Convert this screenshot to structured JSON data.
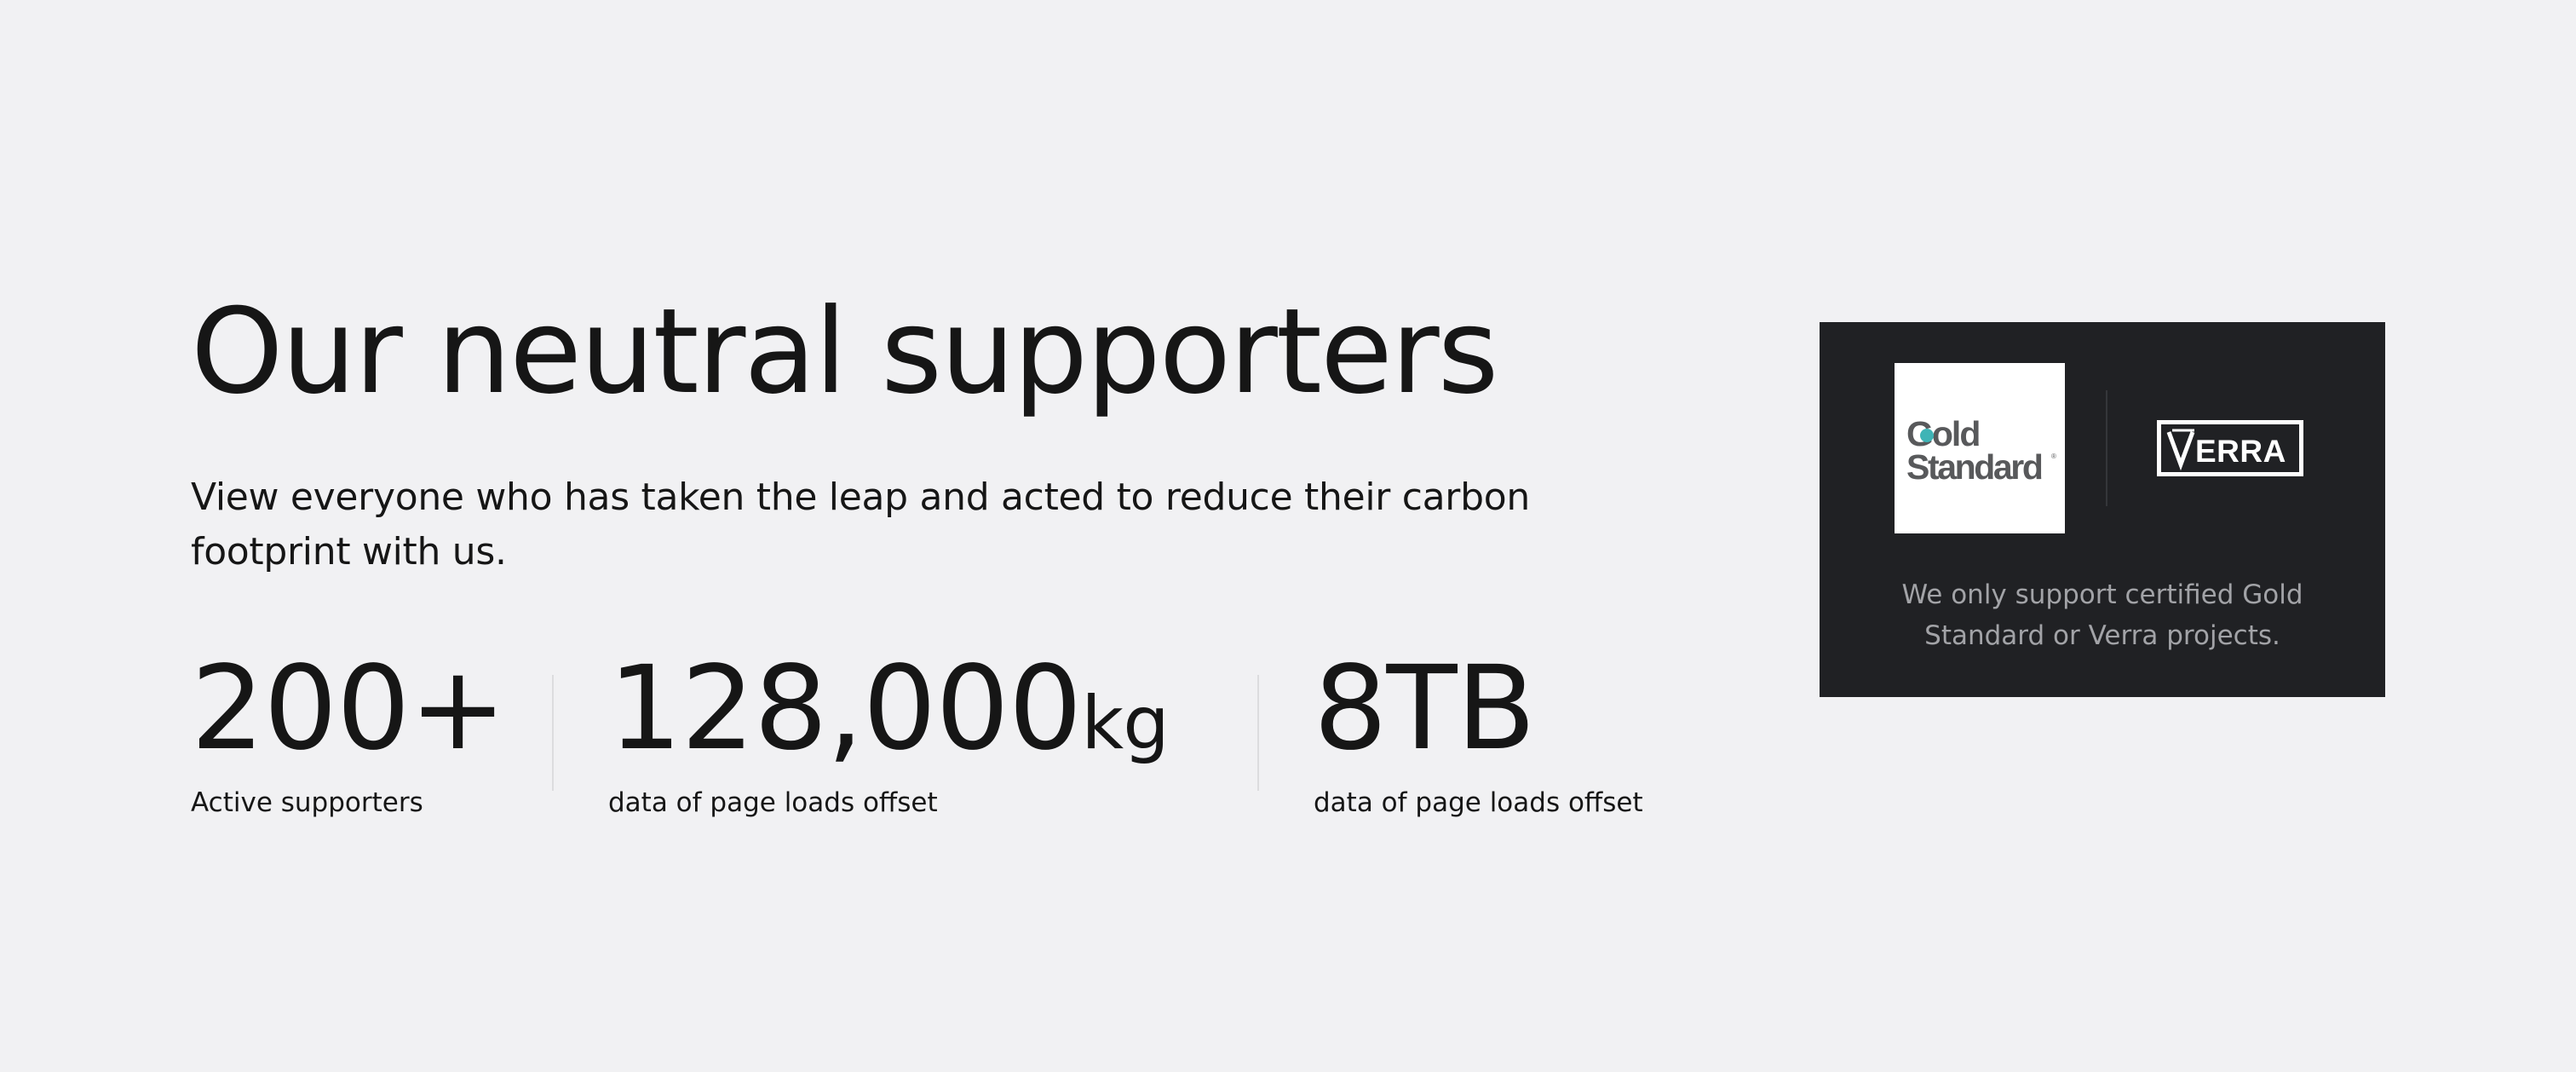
{
  "hero": {
    "title": "Our neutral supporters",
    "subtitle": "View everyone who has taken the leap and acted to reduce their carbon footprint with us."
  },
  "stats": [
    {
      "value": "200+",
      "unit": "",
      "label": "Active supporters"
    },
    {
      "value": "128,000",
      "unit": "kg",
      "label": "data of page loads offset"
    },
    {
      "value": "8TB",
      "unit": "",
      "label": "data of page loads offset"
    }
  ],
  "certification": {
    "logos": [
      {
        "name": "Gold Standard",
        "icon": "gold-standard-logo"
      },
      {
        "name": "VERRA",
        "icon": "verra-logo"
      }
    ],
    "note": "We only support certified Gold Standard or Verra projects."
  },
  "colors": {
    "page_background": "#f1f1f3",
    "text": "#161616",
    "card_background": "#202124",
    "card_text": "#a2a3a7",
    "gold_standard_gray": "#58595b",
    "gold_standard_teal": "#3fb4b6"
  }
}
